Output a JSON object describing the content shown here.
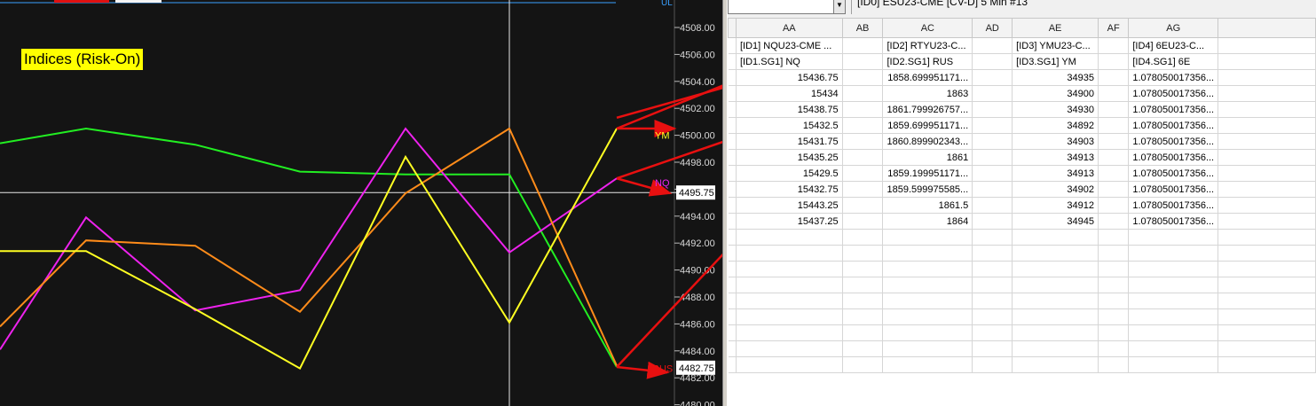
{
  "chart": {
    "title": "Indices (Risk-On)",
    "top_label": "UL",
    "y_axis_ticks": [
      "4508.00",
      "4506.00",
      "4504.00",
      "4502.00",
      "4500.00",
      "4498.00",
      "4496.00",
      "4494.00",
      "4492.00",
      "4490.00",
      "4488.00",
      "4486.00",
      "4484.00",
      "4482.00",
      "4480.00"
    ],
    "price_marker_upper": "4495.75",
    "price_marker_lower": "4482.75",
    "series_labels": {
      "ym": "YM",
      "nq": "NQ",
      "rus": "RUS"
    },
    "colors": {
      "background": "#141414",
      "green": "#22ee22",
      "magenta": "#ee22ee",
      "orange": "#ff8c1a",
      "yellow": "#ffff22",
      "arrow": "#e81010"
    }
  },
  "chart_data": {
    "type": "line",
    "y_unit": "ES price scale",
    "ylim": [
      4480,
      4509
    ],
    "series": [
      {
        "name": "",
        "color": "green",
        "values": [
          4499.4,
          4500.5,
          4499.3,
          4497.3,
          4497.1,
          4497.1,
          4482.8
        ]
      },
      {
        "name": "",
        "color": "magenta",
        "values": [
          4484.1,
          4493.9,
          4487.0,
          4488.5,
          4500.5,
          4491.3,
          4496.8
        ]
      },
      {
        "name": "",
        "color": "orange",
        "values": [
          4485.8,
          4492.2,
          4491.8,
          4486.9,
          4495.7,
          4500.5,
          4482.9
        ]
      },
      {
        "name": "",
        "color": "yellow",
        "values": [
          4491.4,
          4491.4,
          4487.1,
          4482.7,
          4498.4,
          4486.1,
          4500.5
        ]
      }
    ]
  },
  "sheet": {
    "namebox_value": "",
    "formula_text": "[ID0] ESU23-CME [CV-D]  5 Min  #13",
    "columns": [
      "AA",
      "AB",
      "AC",
      "AD",
      "AE",
      "AF",
      "AG"
    ],
    "header_row1": [
      "[ID1] NQU23-CME ...",
      "",
      "[ID2] RTYU23-C...",
      "",
      "[ID3] YMU23-C...",
      "",
      "[ID4] 6EU23-C..."
    ],
    "header_row2": [
      "[ID1.SG1] NQ",
      "",
      "[ID2.SG1] RUS",
      "",
      "[ID3.SG1] YM",
      "",
      "[ID4.SG1] 6E"
    ],
    "rows": [
      [
        "15436.75",
        "",
        "1858.699951171...",
        "",
        "34935",
        "",
        "1.078050017356..."
      ],
      [
        "15434",
        "",
        "1863",
        "",
        "34900",
        "",
        "1.078050017356..."
      ],
      [
        "15438.75",
        "",
        "1861.799926757...",
        "",
        "34930",
        "",
        "1.078050017356..."
      ],
      [
        "15432.5",
        "",
        "1859.699951171...",
        "",
        "34892",
        "",
        "1.078050017356..."
      ],
      [
        "15431.75",
        "",
        "1860.899902343...",
        "",
        "34903",
        "",
        "1.078050017356..."
      ],
      [
        "15435.25",
        "",
        "1861",
        "",
        "34913",
        "",
        "1.078050017356..."
      ],
      [
        "15429.5",
        "",
        "1859.199951171...",
        "",
        "34913",
        "",
        "1.078050017356..."
      ],
      [
        "15432.75",
        "",
        "1859.599975585...",
        "",
        "34902",
        "",
        "1.078050017356..."
      ],
      [
        "15443.25",
        "",
        "1861.5",
        "",
        "34912",
        "",
        "1.078050017356..."
      ],
      [
        "15437.25",
        "",
        "1864",
        "",
        "34945",
        "",
        "1.078050017356..."
      ]
    ],
    "empty_rows": 9
  }
}
